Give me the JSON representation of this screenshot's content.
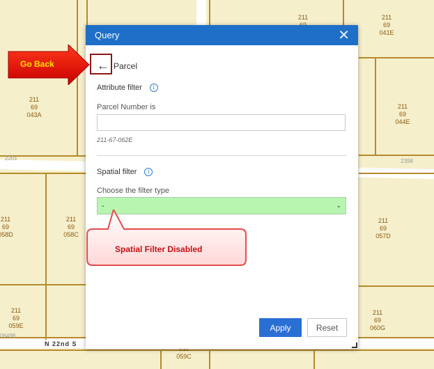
{
  "map": {
    "parcels": [
      {
        "line1": "211",
        "line2": "69",
        "line3": "043A"
      },
      {
        "line1": "211",
        "line2": "69",
        "line3": "041E"
      },
      {
        "line1": "211",
        "line2": "69",
        "line3": "044E"
      },
      {
        "line1": "211",
        "line2": "69",
        "line3": "058D"
      },
      {
        "line1": "211",
        "line2": "69",
        "line3": "058C"
      },
      {
        "line1": "211",
        "line2": "69",
        "line3": "057D"
      },
      {
        "line1": "211",
        "line2": "69",
        "line3": "059E"
      },
      {
        "line1": "211",
        "line2": "69",
        "line3": "060G"
      },
      {
        "line1": "211",
        "line2": "69",
        "line3": ""
      },
      {
        "line1": "211",
        "line2": "",
        "line3": "059C"
      }
    ],
    "street_numbers": [
      "2201",
      "2398",
      "06498"
    ],
    "street_name": "N 22nd S"
  },
  "panel": {
    "title": "Query",
    "close_icon": "close-icon",
    "layer_name": "Parcel",
    "attribute_filter_label": "Attribute filter",
    "parcel_number_label": "Parcel Number is",
    "parcel_number_value": "",
    "parcel_number_hint": "211-67-062E",
    "spatial_filter_label": "Spatial filter",
    "filter_type_label": "Choose the filter type",
    "filter_type_value": "-",
    "apply_label": "Apply",
    "reset_label": "Reset"
  },
  "annotations": {
    "go_back": "Go Back",
    "spatial_disabled": "Spatial Filter Disabled"
  },
  "colors": {
    "header": "#1e6fc8",
    "apply": "#2a6fd4",
    "select_bg": "#b8f5b0",
    "callout_red": "#e81010"
  }
}
